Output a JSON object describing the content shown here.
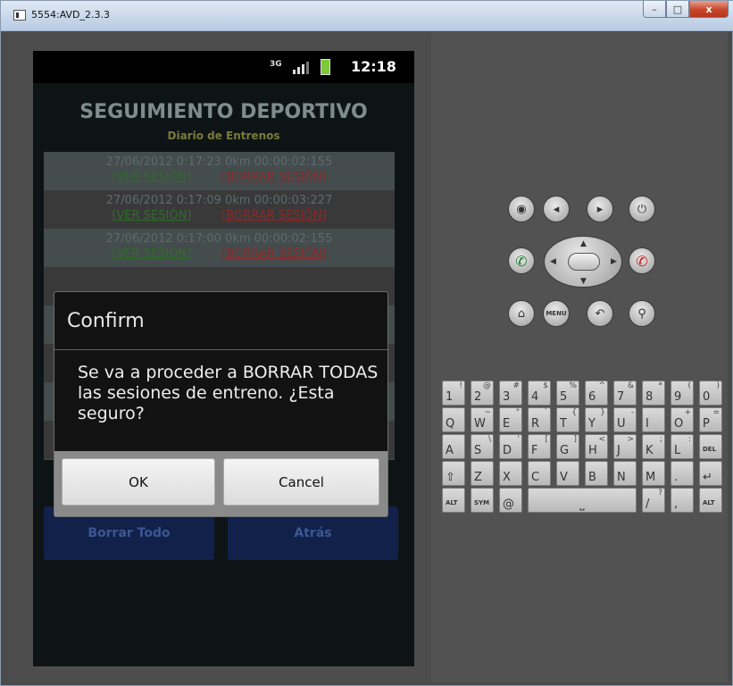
{
  "window": {
    "title": "5554:AVD_2.3.3",
    "min": "–",
    "max": "□",
    "close": "x"
  },
  "status": {
    "network": "3G",
    "time": "12:18"
  },
  "app": {
    "title": "SEGUIMIENTO DEPORTIVO",
    "subtitle": "Diario de Entrenos",
    "sessions": [
      {
        "info": "27/06/2012 0:17:23 0km 00:00:02:155",
        "ver": "[VER SESIÓN]",
        "borrar": "[BORRAR SESIÓN]"
      },
      {
        "info": "27/06/2012 0:17:09 0km 00:00:03:227",
        "ver": "[VER SESIÓN]",
        "borrar": "[BORRAR SESIÓN]"
      },
      {
        "info": "27/06/2012 0:17:00 0km 00:00:02:155",
        "ver": "[VER SESIÓN]",
        "borrar": "[BORRAR SESIÓN]"
      },
      {
        "info": "",
        "ver": "",
        "borrar": ""
      },
      {
        "info": "",
        "ver": "",
        "borrar": ""
      },
      {
        "info": "",
        "ver": "",
        "borrar": ""
      },
      {
        "info": "",
        "ver": "",
        "borrar": ""
      },
      {
        "info": "",
        "ver": "",
        "borrar": ""
      }
    ],
    "borrar_todo": "Borrar Todo",
    "atras": "Atrás"
  },
  "dialog": {
    "title": "Confirm",
    "message": "Se va a proceder a BORRAR TODAS las sesiones de entreno. ¿Esta seguro?",
    "ok": "OK",
    "cancel": "Cancel"
  },
  "controls": {
    "menu": "MENU"
  },
  "keyboard": {
    "row1": [
      [
        "1",
        "!"
      ],
      [
        "2",
        "@"
      ],
      [
        "3",
        "#"
      ],
      [
        "4",
        "$"
      ],
      [
        "5",
        "%"
      ],
      [
        "6",
        "^"
      ],
      [
        "7",
        "&"
      ],
      [
        "8",
        "*"
      ],
      [
        "9",
        "("
      ],
      [
        "0",
        ")"
      ]
    ],
    "row2": [
      [
        "Q",
        ""
      ],
      [
        "W",
        "~"
      ],
      [
        "E",
        "\""
      ],
      [
        "R",
        "`"
      ],
      [
        "T",
        "{"
      ],
      [
        "Y",
        "}"
      ],
      [
        "U",
        "-"
      ],
      [
        "I",
        ""
      ],
      [
        "O",
        "+"
      ],
      [
        "P",
        "="
      ]
    ],
    "row3": [
      [
        "A",
        ""
      ],
      [
        "S",
        "\\"
      ],
      [
        "D",
        "'"
      ],
      [
        "F",
        "["
      ],
      [
        "G",
        "]"
      ],
      [
        "H",
        "<"
      ],
      [
        "J",
        ">"
      ],
      [
        "K",
        ";"
      ],
      [
        "L",
        ":"
      ],
      [
        "DEL",
        ""
      ]
    ],
    "row4": [
      [
        "⇧",
        ""
      ],
      [
        "Z",
        ""
      ],
      [
        "X",
        ""
      ],
      [
        "C",
        ""
      ],
      [
        "V",
        ""
      ],
      [
        "B",
        ""
      ],
      [
        "N",
        ""
      ],
      [
        "M",
        ""
      ],
      [
        ".",
        ""
      ],
      [
        "↵",
        ""
      ]
    ],
    "row5": {
      "alt": "ALT",
      "sym": "SYM",
      "at": "@",
      "space": "⎵",
      "slash": "/",
      "slash_sub": "?",
      "comma": ",",
      "alt2": "ALT"
    }
  },
  "colors": {
    "ver": "#2f6d2a",
    "borrar": "#8a2a2a",
    "dialog_bg": "#121212",
    "action_btn": "#11214a"
  }
}
